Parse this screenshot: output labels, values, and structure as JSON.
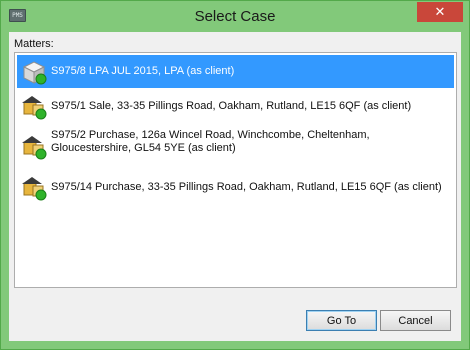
{
  "window": {
    "title": "Select Case",
    "close_glyph": "✕",
    "app_icon_text": "PMS"
  },
  "list": {
    "label": "Matters:",
    "items": [
      {
        "text": "S975/8 LPA JUL 2015, LPA (as client)",
        "icon": "case-box-icon",
        "selected": true
      },
      {
        "text": "S975/1 Sale, 33-35 Pillings Road, Oakham, Rutland, LE15 6QF (as client)",
        "icon": "house-sale-icon"
      },
      {
        "text": "S975/2 Purchase, 126a Wincel Road, Winchcombe, Cheltenham, Gloucestershire, GL54 5YE (as client)",
        "icon": "house-purchase-icon"
      },
      {
        "text": "S975/14 Purchase, 33-35 Pillings Road, Oakham, Rutland, LE15 6QF (as client)",
        "icon": "house-purchase-icon"
      }
    ]
  },
  "buttons": {
    "goto": "Go To",
    "cancel": "Cancel"
  },
  "colors": {
    "title_bar": "#82c97a",
    "selection": "#3399ff",
    "status_green": "#2fb32a"
  }
}
